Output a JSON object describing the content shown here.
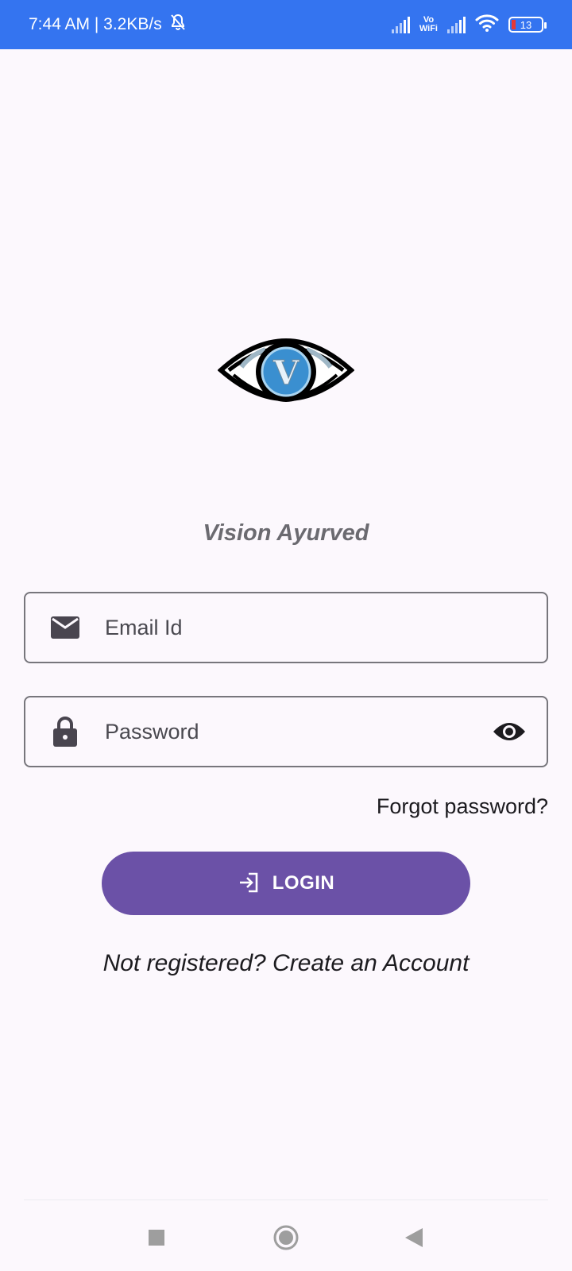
{
  "status_bar": {
    "time_speed": "7:44 AM | 3.2KB/s",
    "vowifi_top": "Vo",
    "vowifi_bottom": "WiFi",
    "battery_level": "13"
  },
  "app": {
    "name": "Vision Ayurved",
    "logo_letter": "V"
  },
  "form": {
    "email_placeholder": "Email Id",
    "email_value": "",
    "password_placeholder": "Password",
    "password_value": "",
    "forgot_label": "Forgot password?",
    "login_label": "LOGIN",
    "register_label": "Not registered? Create an Account"
  },
  "icons": {
    "email": "mail-icon",
    "password": "lock-icon",
    "visibility": "eye-icon",
    "login": "login-icon"
  },
  "colors": {
    "status_bar": "#3474f0",
    "primary": "#6b51a7",
    "background": "#fcf8fd"
  }
}
